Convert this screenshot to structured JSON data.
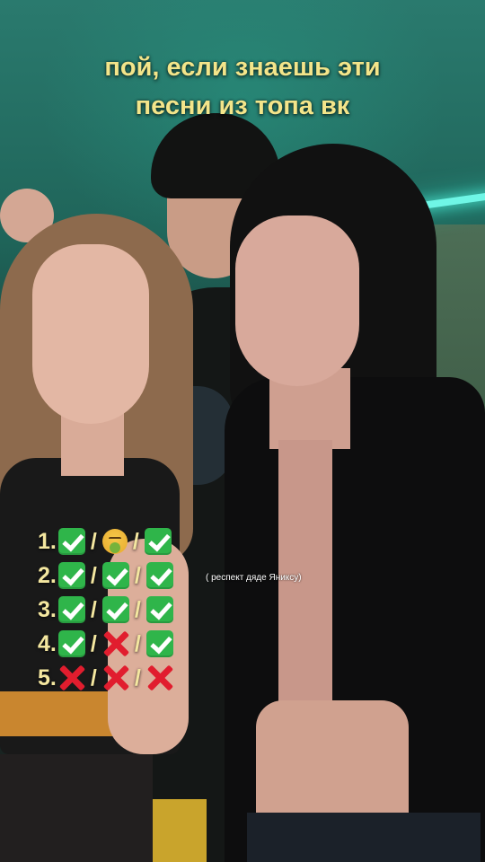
{
  "caption": {
    "line1": "пой, если знаешь эти",
    "line2": "песни из топа вк",
    "color": "#f3e58a"
  },
  "score_rows": [
    {
      "number": "1.",
      "marks": [
        "check-icon",
        "nauseated-face-icon",
        "check-icon"
      ]
    },
    {
      "number": "2.",
      "marks": [
        "check-icon",
        "check-icon",
        "check-icon"
      ]
    },
    {
      "number": "3.",
      "marks": [
        "check-icon",
        "check-icon",
        "check-icon"
      ]
    },
    {
      "number": "4.",
      "marks": [
        "check-icon",
        "cross-mark-icon",
        "check-icon"
      ]
    },
    {
      "number": "5.",
      "marks": [
        "cross-mark-icon",
        "cross-mark-icon",
        "cross-mark-icon"
      ]
    }
  ],
  "separator": "/",
  "note": "( респект дяде Яниксу)",
  "colors": {
    "check": "#2fb54a",
    "cross": "#e11d2e",
    "neon": "#6ff6e6"
  }
}
